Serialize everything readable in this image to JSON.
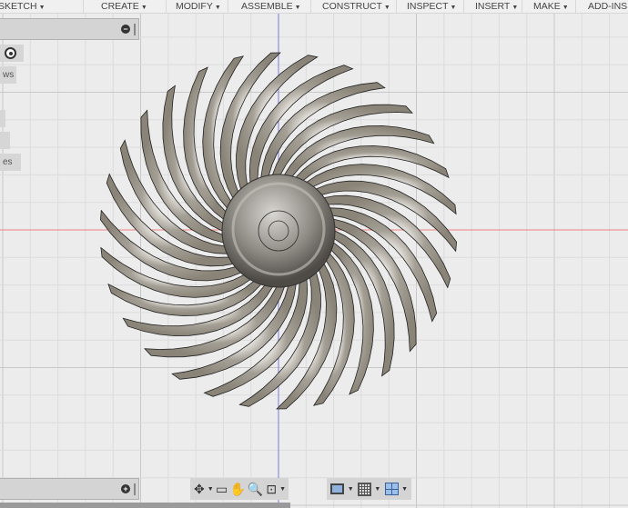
{
  "toolbar": {
    "menus": [
      {
        "label": "SKETCH"
      },
      {
        "label": "CREATE"
      },
      {
        "label": "MODIFY"
      },
      {
        "label": "ASSEMBLE"
      },
      {
        "label": "CONSTRUCT"
      },
      {
        "label": "INSPECT"
      },
      {
        "label": "INSERT"
      },
      {
        "label": "MAKE"
      },
      {
        "label": "ADD-INS"
      }
    ]
  },
  "left_panel": {
    "chips": [
      "ws",
      "",
      "",
      "es"
    ]
  },
  "model": {
    "blade_count": 30,
    "body_color": "#8a8478",
    "hub_color": "#6e6a64"
  },
  "axes": {
    "x_color": "#f08080",
    "y_color": "#7b7bdc"
  },
  "navbar": {
    "icons": [
      "orbit-icon",
      "look-at-icon",
      "pan-hand-icon",
      "zoom-icon",
      "fit-zoom-icon",
      "display-settings-icon",
      "grid-settings-icon",
      "viewports-icon"
    ]
  }
}
